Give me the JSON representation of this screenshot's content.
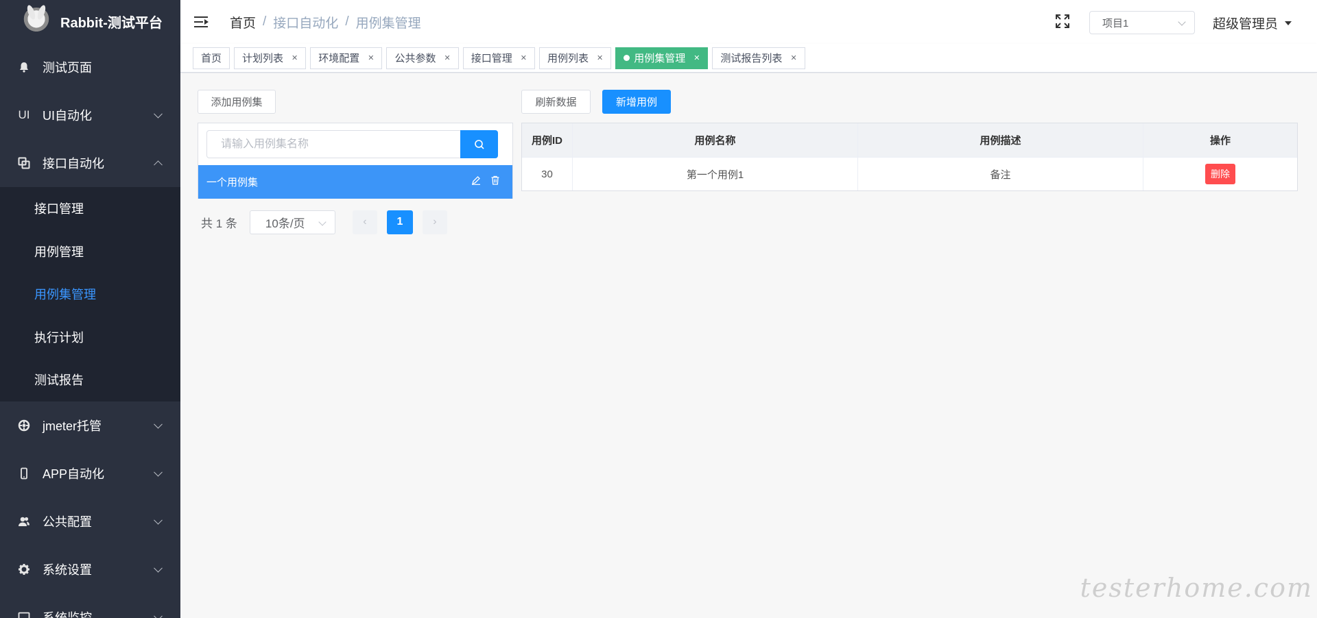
{
  "app": {
    "title": "Rabbit-测试平台"
  },
  "sidebar": {
    "items": [
      {
        "label": "测试页面",
        "icon": "bell-icon",
        "expanded": false,
        "has_children": false
      },
      {
        "label": "UI自动化",
        "icon": "ui-text-icon",
        "icon_text": "UI",
        "expanded": false,
        "has_children": true
      },
      {
        "label": "接口自动化",
        "icon": "api-icon",
        "expanded": true,
        "has_children": true,
        "children": [
          {
            "label": "接口管理",
            "active": false
          },
          {
            "label": "用例管理",
            "active": false
          },
          {
            "label": "用例集管理",
            "active": true
          },
          {
            "label": "执行计划",
            "active": false
          },
          {
            "label": "测试报告",
            "active": false
          }
        ]
      },
      {
        "label": "jmeter托管",
        "icon": "aperture-icon",
        "expanded": false,
        "has_children": true
      },
      {
        "label": "APP自动化",
        "icon": "phone-icon",
        "expanded": false,
        "has_children": true
      },
      {
        "label": "公共配置",
        "icon": "users-icon",
        "expanded": false,
        "has_children": true
      },
      {
        "label": "系统设置",
        "icon": "gear-icon",
        "expanded": false,
        "has_children": true
      },
      {
        "label": "系统监控",
        "icon": "monitor-icon",
        "expanded": false,
        "has_children": true
      }
    ]
  },
  "header": {
    "breadcrumb": [
      "首页",
      "接口自动化",
      "用例集管理"
    ],
    "project": "项目1",
    "user": "超级管理员"
  },
  "tags": [
    {
      "label": "首页",
      "closable": false,
      "active": false
    },
    {
      "label": "计划列表",
      "closable": true,
      "active": false
    },
    {
      "label": "环境配置",
      "closable": true,
      "active": false
    },
    {
      "label": "公共参数",
      "closable": true,
      "active": false
    },
    {
      "label": "接口管理",
      "closable": true,
      "active": false
    },
    {
      "label": "用例列表",
      "closable": true,
      "active": false
    },
    {
      "label": "用例集管理",
      "closable": true,
      "active": true
    },
    {
      "label": "测试报告列表",
      "closable": true,
      "active": false
    }
  ],
  "suites": {
    "add_button": "添加用例集",
    "search_placeholder": "请输入用例集名称",
    "items": [
      {
        "name": "一个用例集",
        "selected": true
      }
    ],
    "pagination": {
      "total_text": "共 1 条",
      "page_size": "10条/页",
      "current_page": "1"
    }
  },
  "cases": {
    "refresh_button": "刷新数据",
    "add_button": "新增用例",
    "columns": [
      "用例ID",
      "用例名称",
      "用例描述",
      "操作"
    ],
    "rows": [
      {
        "id": "30",
        "name": "第一个用例1",
        "desc": "备注",
        "action": "删除"
      }
    ]
  },
  "watermark": "testerhome.com",
  "colors": {
    "sidebar_bg": "#2b313f",
    "primary": "#1890ff",
    "active_tag": "#42b983",
    "danger": "#ff4d4f",
    "active_menu_text": "#3a96ff"
  }
}
